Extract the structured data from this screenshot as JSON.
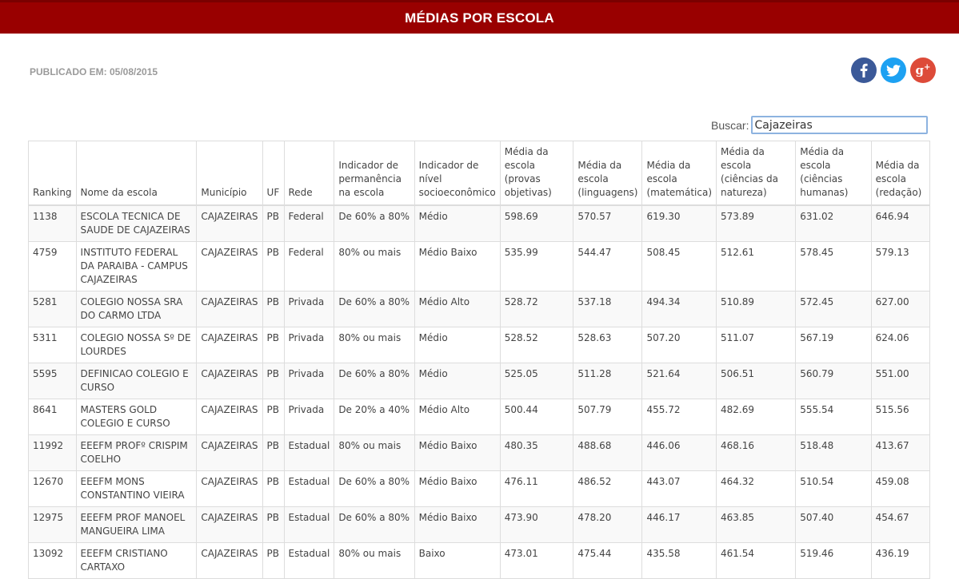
{
  "header": {
    "title": "MÉDIAS POR ESCOLA"
  },
  "published": "PUBLICADO EM: 05/08/2015",
  "social": [
    {
      "name": "facebook",
      "glyph": "f",
      "color": "#3b5998"
    },
    {
      "name": "twitter",
      "glyph": "t",
      "color": "#1da1f2"
    },
    {
      "name": "google-plus",
      "glyph": "g+",
      "color": "#dd4b39"
    }
  ],
  "search": {
    "label": "Buscar:",
    "value": "Cajazeiras"
  },
  "table": {
    "columns": [
      "Ranking",
      "Nome da escola",
      "Município",
      "UF",
      "Rede",
      "Indicador de permanência na escola",
      "Indicador de nível socioeconômico",
      "Média da escola (provas objetivas)",
      "Média da escola (linguagens)",
      "Média da escola (matemática)",
      "Média da escola (ciências da natureza)",
      "Média da escola (ciências humanas)",
      "Média da escola (redação)"
    ],
    "rows": [
      [
        "1138",
        "ESCOLA TECNICA DE SAUDE DE CAJAZEIRAS",
        "CAJAZEIRAS",
        "PB",
        "Federal",
        "De 60% a 80%",
        "Médio",
        "598.69",
        "570.57",
        "619.30",
        "573.89",
        "631.02",
        "646.94"
      ],
      [
        "4759",
        "INSTITUTO FEDERAL DA PARAIBA - CAMPUS CAJAZEIRAS",
        "CAJAZEIRAS",
        "PB",
        "Federal",
        "80% ou mais",
        "Médio Baixo",
        "535.99",
        "544.47",
        "508.45",
        "512.61",
        "578.45",
        "579.13"
      ],
      [
        "5281",
        "COLEGIO NOSSA SRA DO CARMO LTDA",
        "CAJAZEIRAS",
        "PB",
        "Privada",
        "De 60% a 80%",
        "Médio Alto",
        "528.72",
        "537.18",
        "494.34",
        "510.89",
        "572.45",
        "627.00"
      ],
      [
        "5311",
        "COLEGIO NOSSA Sº DE LOURDES",
        "CAJAZEIRAS",
        "PB",
        "Privada",
        "80% ou mais",
        "Médio",
        "528.52",
        "528.63",
        "507.20",
        "511.07",
        "567.19",
        "624.06"
      ],
      [
        "5595",
        "DEFINICAO COLEGIO E CURSO",
        "CAJAZEIRAS",
        "PB",
        "Privada",
        "De 60% a 80%",
        "Médio",
        "525.05",
        "511.28",
        "521.64",
        "506.51",
        "560.79",
        "551.00"
      ],
      [
        "8641",
        "MASTERS GOLD COLEGIO E CURSO",
        "CAJAZEIRAS",
        "PB",
        "Privada",
        "De 20% a 40%",
        "Médio Alto",
        "500.44",
        "507.79",
        "455.72",
        "482.69",
        "555.54",
        "515.56"
      ],
      [
        "11992",
        "EEEFM PROFº CRISPIM COELHO",
        "CAJAZEIRAS",
        "PB",
        "Estadual",
        "80% ou mais",
        "Médio Baixo",
        "480.35",
        "488.68",
        "446.06",
        "468.16",
        "518.48",
        "413.67"
      ],
      [
        "12670",
        "EEEFM MONS CONSTANTINO VIEIRA",
        "CAJAZEIRAS",
        "PB",
        "Estadual",
        "De 60% a 80%",
        "Médio Baixo",
        "476.11",
        "486.52",
        "443.07",
        "464.32",
        "510.54",
        "459.08"
      ],
      [
        "12975",
        "EEEFM PROF MANOEL MANGUEIRA LIMA",
        "CAJAZEIRAS",
        "PB",
        "Estadual",
        "De 60% a 80%",
        "Médio Baixo",
        "473.90",
        "478.20",
        "446.17",
        "463.85",
        "507.40",
        "454.67"
      ],
      [
        "13092",
        "EEEFM CRISTIANO CARTAXO",
        "CAJAZEIRAS",
        "PB",
        "Estadual",
        "80% ou mais",
        "Baixo",
        "473.01",
        "475.44",
        "435.58",
        "461.54",
        "519.46",
        "436.19"
      ]
    ]
  }
}
